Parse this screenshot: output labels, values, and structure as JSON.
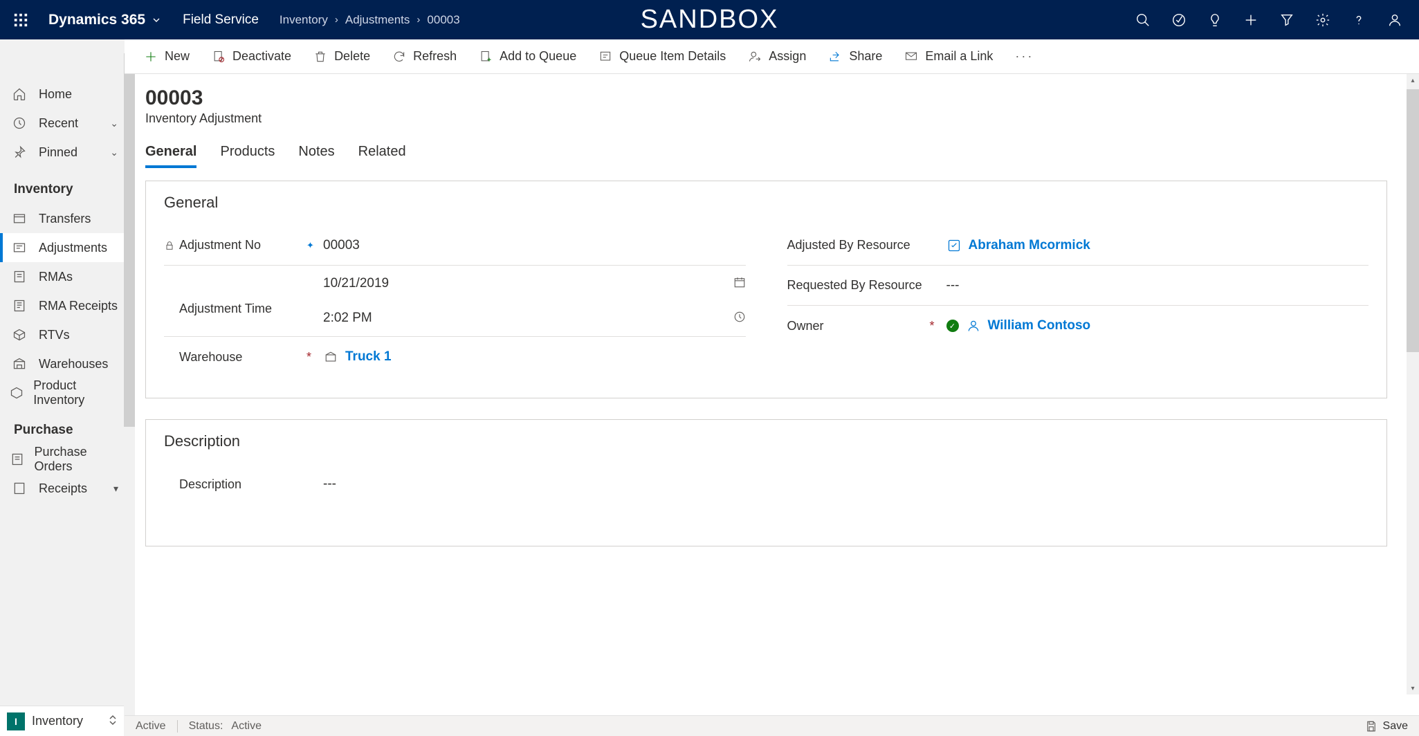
{
  "topnav": {
    "brand": "Dynamics 365",
    "app": "Field Service",
    "breadcrumb": [
      "Inventory",
      "Adjustments",
      "00003"
    ],
    "environment": "SANDBOX"
  },
  "sidebar": {
    "top": [
      {
        "label": "Home",
        "icon": "home-icon"
      },
      {
        "label": "Recent",
        "icon": "clock-icon",
        "expandable": true
      },
      {
        "label": "Pinned",
        "icon": "pin-icon",
        "expandable": true
      }
    ],
    "groups": [
      {
        "header": "Inventory",
        "items": [
          {
            "label": "Transfers",
            "icon": "transfer-icon"
          },
          {
            "label": "Adjustments",
            "icon": "adjustment-icon",
            "selected": true
          },
          {
            "label": "RMAs",
            "icon": "rma-icon"
          },
          {
            "label": "RMA Receipts",
            "icon": "receipt-icon"
          },
          {
            "label": "RTVs",
            "icon": "rtv-icon"
          },
          {
            "label": "Warehouses",
            "icon": "warehouse-icon"
          },
          {
            "label": "Product Inventory",
            "icon": "product-inventory-icon"
          }
        ]
      },
      {
        "header": "Purchase",
        "items": [
          {
            "label": "Purchase Orders",
            "icon": "purchase-order-icon"
          },
          {
            "label": "Receipts",
            "icon": "receipt2-icon"
          }
        ]
      }
    ],
    "area": {
      "badge": "I",
      "label": "Inventory"
    }
  },
  "commands": {
    "new": "New",
    "deactivate": "Deactivate",
    "delete": "Delete",
    "refresh": "Refresh",
    "add_to_queue": "Add to Queue",
    "queue_item_details": "Queue Item Details",
    "assign": "Assign",
    "share": "Share",
    "email_a_link": "Email a Link"
  },
  "record": {
    "title": "00003",
    "subtitle": "Inventory Adjustment",
    "tabs": [
      "General",
      "Products",
      "Notes",
      "Related"
    ],
    "active_tab": 0,
    "sections": {
      "general": {
        "title": "General",
        "fields": {
          "adjustment_no": {
            "label": "Adjustment No",
            "value": "00003",
            "locked": true,
            "recommended": true
          },
          "adjustment_time": {
            "label": "Adjustment Time",
            "date": "10/21/2019",
            "time": "2:02 PM"
          },
          "warehouse": {
            "label": "Warehouse",
            "value": "Truck 1",
            "required": true,
            "lookup_icon": "warehouse-icon"
          },
          "adjusted_by": {
            "label": "Adjusted By Resource",
            "value": "Abraham Mcormick",
            "lookup_icon": "resource-icon"
          },
          "requested_by": {
            "label": "Requested By Resource",
            "value": "---"
          },
          "owner": {
            "label": "Owner",
            "value": "William Contoso",
            "required": true,
            "lookup_icon": "person-icon",
            "status_ok": true
          }
        }
      },
      "description": {
        "title": "Description",
        "fields": {
          "description": {
            "label": "Description",
            "value": "---"
          }
        }
      }
    }
  },
  "statusbar": {
    "state": "Active",
    "status_label": "Status:",
    "status_value": "Active",
    "save_label": "Save"
  }
}
